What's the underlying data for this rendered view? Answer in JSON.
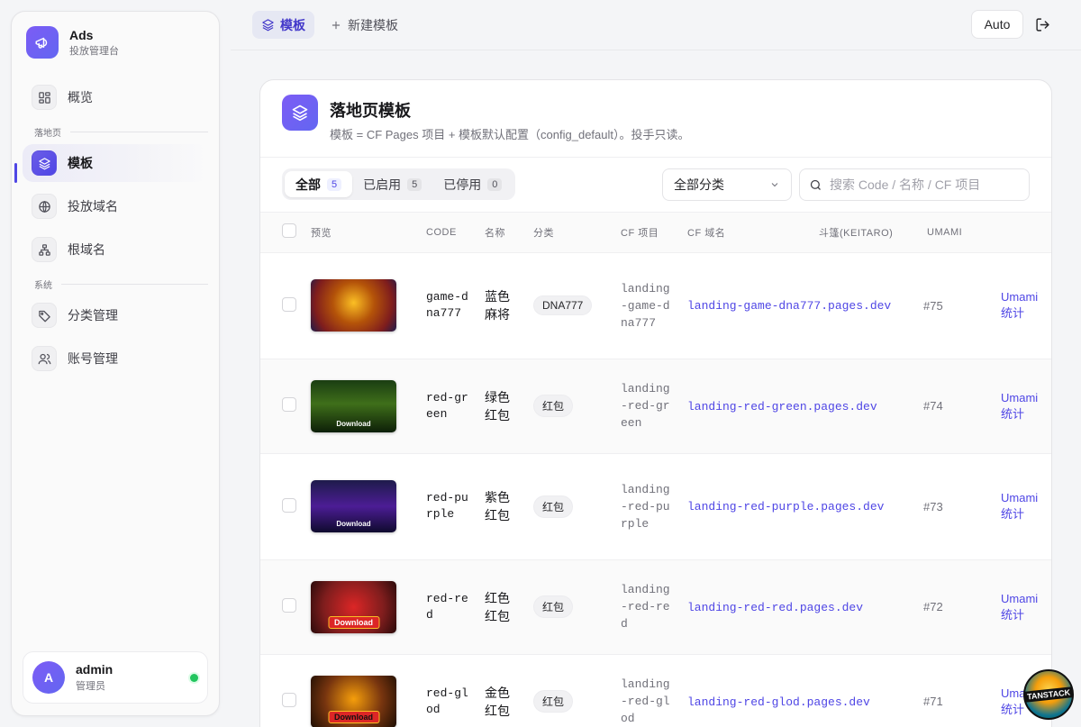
{
  "brand": {
    "title": "Ads",
    "subtitle": "投放管理台"
  },
  "sidebar": {
    "items": [
      {
        "label": "概览"
      },
      {
        "label": "模板"
      },
      {
        "label": "投放域名"
      },
      {
        "label": "根域名"
      },
      {
        "label": "分类管理"
      },
      {
        "label": "账号管理"
      }
    ],
    "sections": {
      "landing": "落地页",
      "system": "系统"
    },
    "active": "模板"
  },
  "user": {
    "initial": "A",
    "name": "admin",
    "role": "管理员"
  },
  "topbar": {
    "tabs": [
      {
        "label": "模板"
      },
      {
        "label": "新建模板"
      }
    ],
    "theme_button": "Auto"
  },
  "page": {
    "title": "落地页模板",
    "description": "模板 = CF Pages 项目 + 模板默认配置（config_default）。投手只读。"
  },
  "filters": {
    "status_tabs": [
      {
        "label": "全部",
        "count": "5"
      },
      {
        "label": "已启用",
        "count": "5"
      },
      {
        "label": "已停用",
        "count": "0"
      }
    ],
    "category_select": "全部分类",
    "search_placeholder": "搜索 Code / 名称 / CF 项目"
  },
  "table": {
    "columns": [
      "预览",
      "CODE",
      "名称",
      "分类",
      "CF 项目",
      "CF 域名",
      "斗篷(KEITARO)",
      "UMAMI"
    ],
    "rows": [
      {
        "code": "game-dna777",
        "name": "蓝色麻将",
        "category": "DNA777",
        "cf_project": "landing-game-dna777",
        "cf_domain": "landing-game-dna777.pages.dev",
        "keitaro": "#75",
        "umami": "Umami 统计",
        "preview_label": ""
      },
      {
        "code": "red-green",
        "name": "绿色红包",
        "category": "红包",
        "cf_project": "landing-red-green",
        "cf_domain": "landing-red-green.pages.dev",
        "keitaro": "#74",
        "umami": "Umami 统计",
        "preview_label": "Download"
      },
      {
        "code": "red-purple",
        "name": "紫色红包",
        "category": "红包",
        "cf_project": "landing-red-purple",
        "cf_domain": "landing-red-purple.pages.dev",
        "keitaro": "#73",
        "umami": "Umami 统计",
        "preview_label": "Download"
      },
      {
        "code": "red-red",
        "name": "红色红包",
        "category": "红包",
        "cf_project": "landing-red-red",
        "cf_domain": "landing-red-red.pages.dev",
        "keitaro": "#72",
        "umami": "Umami 统计",
        "preview_label": "Download"
      },
      {
        "code": "red-glod",
        "name": "金色红包",
        "category": "红包",
        "cf_project": "landing-red-glod",
        "cf_domain": "landing-red-glod.pages.dev",
        "keitaro": "#71",
        "umami": "Umami 统计",
        "preview_label": "Download"
      }
    ]
  },
  "devtools_badge": "TANSTACK",
  "colors": {
    "accent": "#4f46e5",
    "brand_gradient_start": "#7c5cf5",
    "online": "#22c55e"
  }
}
